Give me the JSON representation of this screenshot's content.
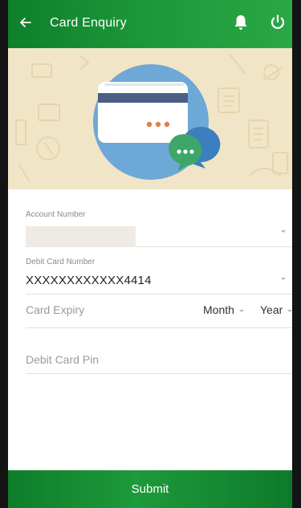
{
  "header": {
    "title": "Card Enquiry",
    "back_icon": "arrow-left-icon",
    "notification_icon": "bell-icon",
    "logout_icon": "power-icon",
    "colors": {
      "primary_green": "#1b9638",
      "banner_bg": "#f1e5c7",
      "circle_blue": "#6ea8d6"
    }
  },
  "banner": {
    "illustration": "credit-card-with-chat-bubble-illustration"
  },
  "form": {
    "account_number": {
      "label": "Account Number",
      "value": ""
    },
    "debit_card_number": {
      "label": "Debit Card Number",
      "value": "XXXXXXXXXXXX4414"
    },
    "card_expiry": {
      "placeholder": "Card Expiry",
      "month_label": "Month",
      "year_label": "Year"
    },
    "debit_card_pin": {
      "placeholder": "Debit Card Pin"
    }
  },
  "footer": {
    "submit_label": "Submit"
  }
}
